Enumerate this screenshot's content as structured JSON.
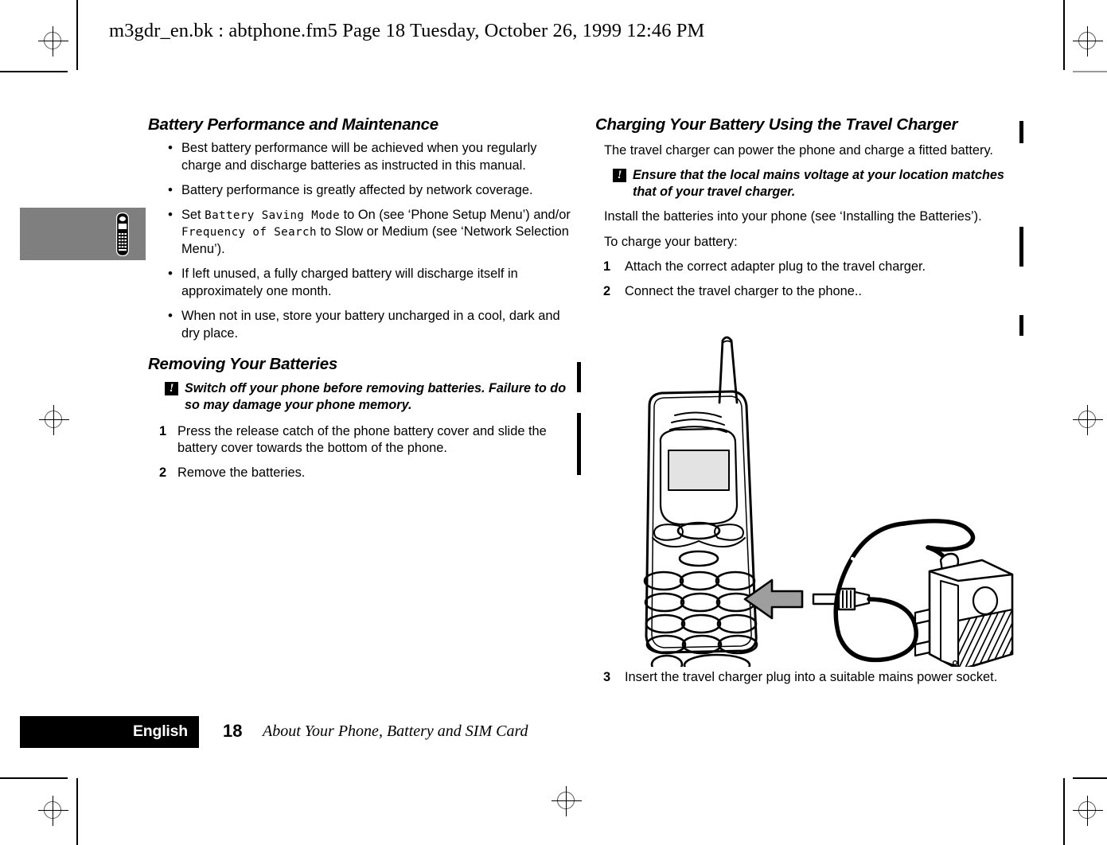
{
  "page": {
    "header": "m3gdr_en.bk : abtphone.fm5  Page 18  Tuesday, October 26, 1999  12:46 PM",
    "folio": "18",
    "language_tab": "English",
    "footer_title": "About Your Phone, Battery and SIM Card",
    "accent_gray": "#7f7f7f",
    "ink": "#000000",
    "paper": "#ffffff"
  },
  "left_column": {
    "heading1": "Battery Performance and Maintenance",
    "bullets": [
      {
        "parts": [
          {
            "type": "text",
            "value": "Best battery performance will be achieved when you regularly charge and discharge batteries as instructed in this manual."
          }
        ]
      },
      {
        "parts": [
          {
            "type": "text",
            "value": "Battery performance is greatly affected by network coverage."
          }
        ]
      },
      {
        "parts": [
          {
            "type": "text",
            "value": "Set "
          },
          {
            "type": "lcd",
            "value": "Battery Saving Mode"
          },
          {
            "type": "text",
            "value": " to On (see ‘Phone Setup Menu’) and/or "
          },
          {
            "type": "lcd",
            "value": "Frequency of Search"
          },
          {
            "type": "text",
            "value": " to Slow or Medium (see ‘Network Selection Menu’)."
          }
        ]
      },
      {
        "parts": [
          {
            "type": "text",
            "value": "If left unused, a fully charged battery will discharge itself in approximately one month."
          }
        ]
      },
      {
        "parts": [
          {
            "type": "text",
            "value": "When not in use, store your battery uncharged in a cool, dark and dry place."
          }
        ]
      }
    ],
    "heading2": "Removing Your Batteries",
    "caution": "Switch off your phone before removing batteries. Failure to do so may damage your phone memory.",
    "caution_icon": "exclamation-warning-icon",
    "steps": [
      {
        "num": "1",
        "text": "Press the release catch of the phone battery cover and slide the battery cover towards the bottom of the phone."
      },
      {
        "num": "2",
        "text": "Remove the batteries."
      }
    ]
  },
  "right_column": {
    "heading1": "Charging Your Battery Using the Travel Charger",
    "intro": "The travel charger can power the phone and charge a fitted battery.",
    "caution": "Ensure that the local mains voltage at your location matches that of your travel charger.",
    "caution_icon": "exclamation-warning-icon",
    "install_note": "Install the batteries into your phone (see ‘Installing the Batteries’).",
    "lead_in": "To charge your battery:",
    "steps": [
      {
        "num": "1",
        "text": "Attach the correct adapter plug to the travel charger."
      },
      {
        "num": "2",
        "text": "Connect the travel charger to the phone.."
      }
    ],
    "steps_after_figure": [
      {
        "num": "3",
        "text": "Insert the travel charger plug into a suitable mains power socket."
      }
    ],
    "figure": {
      "name": "phone-and-travel-charger-illustration",
      "elements": [
        "mobile-phone-icon",
        "antenna",
        "lcd-display",
        "keypad",
        "connector-arrow-icon",
        "charger-plug",
        "cable",
        "travel-charger-unit"
      ]
    }
  },
  "margin": {
    "tab_icon": "mobile-phone-icon"
  }
}
